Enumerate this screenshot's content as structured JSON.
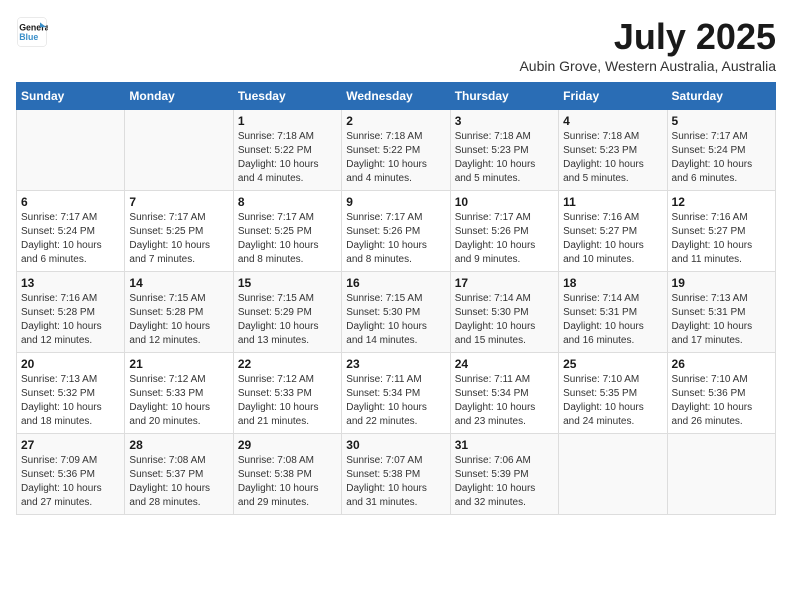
{
  "header": {
    "logo_line1": "General",
    "logo_line2": "Blue",
    "month": "July 2025",
    "location": "Aubin Grove, Western Australia, Australia"
  },
  "days_of_week": [
    "Sunday",
    "Monday",
    "Tuesday",
    "Wednesday",
    "Thursday",
    "Friday",
    "Saturday"
  ],
  "weeks": [
    [
      {
        "day": "",
        "info": ""
      },
      {
        "day": "",
        "info": ""
      },
      {
        "day": "1",
        "info": "Sunrise: 7:18 AM\nSunset: 5:22 PM\nDaylight: 10 hours and 4 minutes."
      },
      {
        "day": "2",
        "info": "Sunrise: 7:18 AM\nSunset: 5:22 PM\nDaylight: 10 hours and 4 minutes."
      },
      {
        "day": "3",
        "info": "Sunrise: 7:18 AM\nSunset: 5:23 PM\nDaylight: 10 hours and 5 minutes."
      },
      {
        "day": "4",
        "info": "Sunrise: 7:18 AM\nSunset: 5:23 PM\nDaylight: 10 hours and 5 minutes."
      },
      {
        "day": "5",
        "info": "Sunrise: 7:17 AM\nSunset: 5:24 PM\nDaylight: 10 hours and 6 minutes."
      }
    ],
    [
      {
        "day": "6",
        "info": "Sunrise: 7:17 AM\nSunset: 5:24 PM\nDaylight: 10 hours and 6 minutes."
      },
      {
        "day": "7",
        "info": "Sunrise: 7:17 AM\nSunset: 5:25 PM\nDaylight: 10 hours and 7 minutes."
      },
      {
        "day": "8",
        "info": "Sunrise: 7:17 AM\nSunset: 5:25 PM\nDaylight: 10 hours and 8 minutes."
      },
      {
        "day": "9",
        "info": "Sunrise: 7:17 AM\nSunset: 5:26 PM\nDaylight: 10 hours and 8 minutes."
      },
      {
        "day": "10",
        "info": "Sunrise: 7:17 AM\nSunset: 5:26 PM\nDaylight: 10 hours and 9 minutes."
      },
      {
        "day": "11",
        "info": "Sunrise: 7:16 AM\nSunset: 5:27 PM\nDaylight: 10 hours and 10 minutes."
      },
      {
        "day": "12",
        "info": "Sunrise: 7:16 AM\nSunset: 5:27 PM\nDaylight: 10 hours and 11 minutes."
      }
    ],
    [
      {
        "day": "13",
        "info": "Sunrise: 7:16 AM\nSunset: 5:28 PM\nDaylight: 10 hours and 12 minutes."
      },
      {
        "day": "14",
        "info": "Sunrise: 7:15 AM\nSunset: 5:28 PM\nDaylight: 10 hours and 12 minutes."
      },
      {
        "day": "15",
        "info": "Sunrise: 7:15 AM\nSunset: 5:29 PM\nDaylight: 10 hours and 13 minutes."
      },
      {
        "day": "16",
        "info": "Sunrise: 7:15 AM\nSunset: 5:30 PM\nDaylight: 10 hours and 14 minutes."
      },
      {
        "day": "17",
        "info": "Sunrise: 7:14 AM\nSunset: 5:30 PM\nDaylight: 10 hours and 15 minutes."
      },
      {
        "day": "18",
        "info": "Sunrise: 7:14 AM\nSunset: 5:31 PM\nDaylight: 10 hours and 16 minutes."
      },
      {
        "day": "19",
        "info": "Sunrise: 7:13 AM\nSunset: 5:31 PM\nDaylight: 10 hours and 17 minutes."
      }
    ],
    [
      {
        "day": "20",
        "info": "Sunrise: 7:13 AM\nSunset: 5:32 PM\nDaylight: 10 hours and 18 minutes."
      },
      {
        "day": "21",
        "info": "Sunrise: 7:12 AM\nSunset: 5:33 PM\nDaylight: 10 hours and 20 minutes."
      },
      {
        "day": "22",
        "info": "Sunrise: 7:12 AM\nSunset: 5:33 PM\nDaylight: 10 hours and 21 minutes."
      },
      {
        "day": "23",
        "info": "Sunrise: 7:11 AM\nSunset: 5:34 PM\nDaylight: 10 hours and 22 minutes."
      },
      {
        "day": "24",
        "info": "Sunrise: 7:11 AM\nSunset: 5:34 PM\nDaylight: 10 hours and 23 minutes."
      },
      {
        "day": "25",
        "info": "Sunrise: 7:10 AM\nSunset: 5:35 PM\nDaylight: 10 hours and 24 minutes."
      },
      {
        "day": "26",
        "info": "Sunrise: 7:10 AM\nSunset: 5:36 PM\nDaylight: 10 hours and 26 minutes."
      }
    ],
    [
      {
        "day": "27",
        "info": "Sunrise: 7:09 AM\nSunset: 5:36 PM\nDaylight: 10 hours and 27 minutes."
      },
      {
        "day": "28",
        "info": "Sunrise: 7:08 AM\nSunset: 5:37 PM\nDaylight: 10 hours and 28 minutes."
      },
      {
        "day": "29",
        "info": "Sunrise: 7:08 AM\nSunset: 5:38 PM\nDaylight: 10 hours and 29 minutes."
      },
      {
        "day": "30",
        "info": "Sunrise: 7:07 AM\nSunset: 5:38 PM\nDaylight: 10 hours and 31 minutes."
      },
      {
        "day": "31",
        "info": "Sunrise: 7:06 AM\nSunset: 5:39 PM\nDaylight: 10 hours and 32 minutes."
      },
      {
        "day": "",
        "info": ""
      },
      {
        "day": "",
        "info": ""
      }
    ]
  ]
}
